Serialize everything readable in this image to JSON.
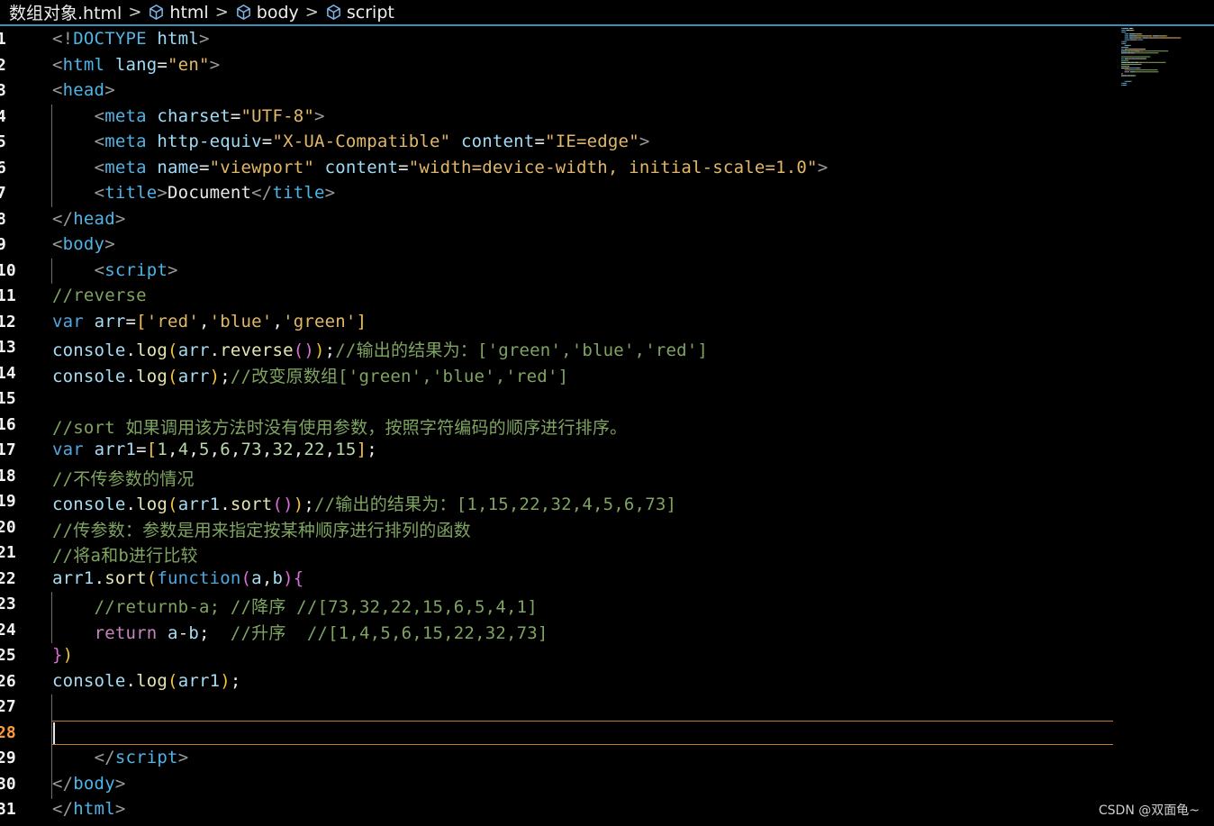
{
  "breadcrumb": {
    "file": "数组对象.html",
    "items": [
      "html",
      "body",
      "script"
    ],
    "separator": ">"
  },
  "active_line": 28,
  "lines": [
    {
      "n": "1",
      "tokens": [
        [
          "punct",
          "<!"
        ],
        [
          "tag",
          "DOCTYPE"
        ],
        [
          "plain",
          " "
        ],
        [
          "attr",
          "html"
        ],
        [
          "punct",
          ">"
        ]
      ]
    },
    {
      "n": "2",
      "tokens": [
        [
          "punct",
          "<"
        ],
        [
          "tag",
          "html"
        ],
        [
          "plain",
          " "
        ],
        [
          "attr",
          "lang"
        ],
        [
          "plain",
          "="
        ],
        [
          "str",
          "\"en\""
        ],
        [
          "punct",
          ">"
        ]
      ]
    },
    {
      "n": "3",
      "tokens": [
        [
          "punct",
          "<"
        ],
        [
          "tag",
          "head"
        ],
        [
          "punct",
          ">"
        ]
      ]
    },
    {
      "n": "4",
      "tokens": [
        [
          "plain",
          "    "
        ],
        [
          "punct",
          "<"
        ],
        [
          "tag",
          "meta"
        ],
        [
          "plain",
          " "
        ],
        [
          "attr",
          "charset"
        ],
        [
          "plain",
          "="
        ],
        [
          "str",
          "\"UTF-8\""
        ],
        [
          "punct",
          ">"
        ]
      ]
    },
    {
      "n": "5",
      "tokens": [
        [
          "plain",
          "    "
        ],
        [
          "punct",
          "<"
        ],
        [
          "tag",
          "meta"
        ],
        [
          "plain",
          " "
        ],
        [
          "attr",
          "http-equiv"
        ],
        [
          "plain",
          "="
        ],
        [
          "str",
          "\"X-UA-Compatible\""
        ],
        [
          "plain",
          " "
        ],
        [
          "attr",
          "content"
        ],
        [
          "plain",
          "="
        ],
        [
          "str",
          "\"IE=edge\""
        ],
        [
          "punct",
          ">"
        ]
      ]
    },
    {
      "n": "6",
      "tokens": [
        [
          "plain",
          "    "
        ],
        [
          "punct",
          "<"
        ],
        [
          "tag",
          "meta"
        ],
        [
          "plain",
          " "
        ],
        [
          "attr",
          "name"
        ],
        [
          "plain",
          "="
        ],
        [
          "str",
          "\"viewport\""
        ],
        [
          "plain",
          " "
        ],
        [
          "attr",
          "content"
        ],
        [
          "plain",
          "="
        ],
        [
          "str",
          "\"width=device-width, initial-scale=1.0\""
        ],
        [
          "punct",
          ">"
        ]
      ]
    },
    {
      "n": "7",
      "tokens": [
        [
          "plain",
          "    "
        ],
        [
          "punct",
          "<"
        ],
        [
          "tag",
          "title"
        ],
        [
          "punct",
          ">"
        ],
        [
          "plain",
          "Document"
        ],
        [
          "punct",
          "</"
        ],
        [
          "tag",
          "title"
        ],
        [
          "punct",
          ">"
        ]
      ]
    },
    {
      "n": "8",
      "tokens": [
        [
          "punct",
          "</"
        ],
        [
          "tag",
          "head"
        ],
        [
          "punct",
          ">"
        ]
      ]
    },
    {
      "n": "9",
      "tokens": [
        [
          "punct",
          "<"
        ],
        [
          "tag",
          "body"
        ],
        [
          "punct",
          ">"
        ]
      ]
    },
    {
      "n": "10",
      "tokens": [
        [
          "plain",
          "    "
        ],
        [
          "punct",
          "<"
        ],
        [
          "tag",
          "script"
        ],
        [
          "punct",
          ">"
        ]
      ]
    },
    {
      "n": "11",
      "tokens": [
        [
          "com",
          "//reverse"
        ]
      ]
    },
    {
      "n": "12",
      "tokens": [
        [
          "kw",
          "var"
        ],
        [
          "plain",
          " "
        ],
        [
          "obj",
          "arr"
        ],
        [
          "plain",
          "="
        ],
        [
          "br1",
          "["
        ],
        [
          "str",
          "'red'"
        ],
        [
          "plain",
          ","
        ],
        [
          "str",
          "'blue'"
        ],
        [
          "plain",
          ","
        ],
        [
          "str",
          "'green'"
        ],
        [
          "br1",
          "]"
        ]
      ]
    },
    {
      "n": "13",
      "tokens": [
        [
          "obj",
          "console"
        ],
        [
          "plain",
          "."
        ],
        [
          "fn",
          "log"
        ],
        [
          "br1",
          "("
        ],
        [
          "obj",
          "arr"
        ],
        [
          "plain",
          "."
        ],
        [
          "fn",
          "reverse"
        ],
        [
          "br2",
          "()"
        ],
        [
          "br1",
          ")"
        ],
        [
          "plain",
          ";"
        ],
        [
          "com",
          "//输出的结果为：['green','blue','red']"
        ]
      ]
    },
    {
      "n": "14",
      "tokens": [
        [
          "obj",
          "console"
        ],
        [
          "plain",
          "."
        ],
        [
          "fn",
          "log"
        ],
        [
          "br1",
          "("
        ],
        [
          "obj",
          "arr"
        ],
        [
          "br1",
          ")"
        ],
        [
          "plain",
          ";"
        ],
        [
          "com",
          "//改变原数组['green','blue','red']"
        ]
      ]
    },
    {
      "n": "15",
      "tokens": []
    },
    {
      "n": "16",
      "tokens": [
        [
          "com",
          "//sort 如果调用该方法时没有使用参数，按照字符编码的顺序进行排序。"
        ]
      ]
    },
    {
      "n": "17",
      "tokens": [
        [
          "kw",
          "var"
        ],
        [
          "plain",
          " "
        ],
        [
          "obj",
          "arr1"
        ],
        [
          "plain",
          "="
        ],
        [
          "br1",
          "["
        ],
        [
          "num",
          "1"
        ],
        [
          "plain",
          ","
        ],
        [
          "num",
          "4"
        ],
        [
          "plain",
          ","
        ],
        [
          "num",
          "5"
        ],
        [
          "plain",
          ","
        ],
        [
          "num",
          "6"
        ],
        [
          "plain",
          ","
        ],
        [
          "num",
          "73"
        ],
        [
          "plain",
          ","
        ],
        [
          "num",
          "32"
        ],
        [
          "plain",
          ","
        ],
        [
          "num",
          "22"
        ],
        [
          "plain",
          ","
        ],
        [
          "num",
          "15"
        ],
        [
          "br1",
          "]"
        ],
        [
          "plain",
          ";"
        ]
      ]
    },
    {
      "n": "18",
      "tokens": [
        [
          "com",
          "//不传参数的情况"
        ]
      ]
    },
    {
      "n": "19",
      "tokens": [
        [
          "obj",
          "console"
        ],
        [
          "plain",
          "."
        ],
        [
          "fn",
          "log"
        ],
        [
          "br1",
          "("
        ],
        [
          "obj",
          "arr1"
        ],
        [
          "plain",
          "."
        ],
        [
          "fn",
          "sort"
        ],
        [
          "br2",
          "()"
        ],
        [
          "br1",
          ")"
        ],
        [
          "plain",
          ";"
        ],
        [
          "com",
          "//输出的结果为：[1,15,22,32,4,5,6,73]"
        ]
      ]
    },
    {
      "n": "20",
      "tokens": [
        [
          "com",
          "//传参数：参数是用来指定按某种顺序进行排列的函数"
        ]
      ]
    },
    {
      "n": "21",
      "tokens": [
        [
          "com",
          "//将a和b进行比较"
        ]
      ]
    },
    {
      "n": "22",
      "tokens": [
        [
          "obj",
          "arr1"
        ],
        [
          "plain",
          "."
        ],
        [
          "fn",
          "sort"
        ],
        [
          "br1",
          "("
        ],
        [
          "kw",
          "function"
        ],
        [
          "br2",
          "("
        ],
        [
          "obj",
          "a"
        ],
        [
          "plain",
          ","
        ],
        [
          "obj",
          "b"
        ],
        [
          "br2",
          ")"
        ],
        [
          "br2",
          "{"
        ]
      ]
    },
    {
      "n": "23",
      "tokens": [
        [
          "plain",
          "    "
        ],
        [
          "com",
          "//returnb-a; //降序 //[73,32,22,15,6,5,4,1]"
        ]
      ]
    },
    {
      "n": "24",
      "tokens": [
        [
          "plain",
          "    "
        ],
        [
          "ret",
          "return"
        ],
        [
          "plain",
          " "
        ],
        [
          "obj",
          "a"
        ],
        [
          "plain",
          "-"
        ],
        [
          "obj",
          "b"
        ],
        [
          "plain",
          ";  "
        ],
        [
          "com",
          "//升序  //[1,4,5,6,15,22,32,73]"
        ]
      ]
    },
    {
      "n": "25",
      "tokens": [
        [
          "br2",
          "}"
        ],
        [
          "br1",
          ")"
        ]
      ]
    },
    {
      "n": "26",
      "tokens": [
        [
          "obj",
          "console"
        ],
        [
          "plain",
          "."
        ],
        [
          "fn",
          "log"
        ],
        [
          "br1",
          "("
        ],
        [
          "obj",
          "arr1"
        ],
        [
          "br1",
          ")"
        ],
        [
          "plain",
          ";"
        ]
      ]
    },
    {
      "n": "27",
      "tokens": []
    },
    {
      "n": "28",
      "tokens": []
    },
    {
      "n": "29",
      "tokens": [
        [
          "plain",
          "    "
        ],
        [
          "punct",
          "</"
        ],
        [
          "tag",
          "script"
        ],
        [
          "punct",
          ">"
        ]
      ]
    },
    {
      "n": "30",
      "tokens": [
        [
          "punct",
          "</"
        ],
        [
          "tag",
          "body"
        ],
        [
          "punct",
          ">"
        ]
      ]
    },
    {
      "n": "31",
      "tokens": [
        [
          "punct",
          "</"
        ],
        [
          "tag",
          "html"
        ],
        [
          "punct",
          ">"
        ]
      ]
    }
  ],
  "watermark": "CSDN @双面龟~",
  "colors": {
    "background": "#000000",
    "breadcrumb_border": "#3a8fb7",
    "active_line_border": "#c77a2e",
    "active_line_number": "#ff9a3c"
  }
}
